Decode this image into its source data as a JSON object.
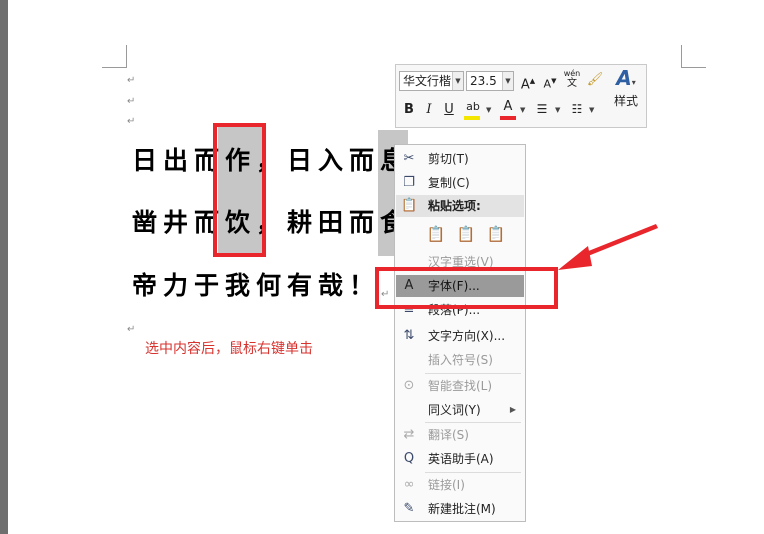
{
  "document": {
    "line1": "日出而作，日入而息",
    "line2": "凿井而饮，耕田而食",
    "line3": "帝力于我何有哉！",
    "paragraph_mark": "↵",
    "caption": "选中内容后，鼠标右键单击"
  },
  "mini_toolbar": {
    "font_name": "华文行楷",
    "font_size": "23.5",
    "grow_font": "A",
    "shrink_font": "A",
    "phonetic_top": "wén",
    "phonetic_bottom": "文",
    "bold": "B",
    "italic": "I",
    "underline": "U",
    "highlight": "ab",
    "font_color": "A",
    "styles_label": "样式"
  },
  "context_menu": {
    "items": [
      {
        "label": "剪切(T)",
        "icon": "scissors-icon"
      },
      {
        "label": "复制(C)",
        "icon": "copy-icon"
      },
      {
        "label": "粘贴选项:",
        "icon": "paste-icon"
      },
      {
        "label": "汉字重选(V)",
        "icon": ""
      },
      {
        "label": "字体(F)...",
        "icon": "font-icon"
      },
      {
        "label": "段落(P)...",
        "icon": "paragraph-icon"
      },
      {
        "label": "文字方向(X)...",
        "icon": "text-direction-icon"
      },
      {
        "label": "插入符号(S)",
        "icon": ""
      },
      {
        "label": "智能查找(L)",
        "icon": "smart-lookup-icon"
      },
      {
        "label": "同义词(Y)",
        "icon": ""
      },
      {
        "label": "翻译(S)",
        "icon": "translate-icon"
      },
      {
        "label": "英语助手(A)",
        "icon": "english-assistant-icon"
      },
      {
        "label": "链接(I)",
        "icon": "link-icon"
      },
      {
        "label": "新建批注(M)",
        "icon": "new-comment-icon"
      }
    ],
    "paste_options": [
      "keep-source-formatting-icon",
      "merge-formatting-icon",
      "keep-text-only-icon"
    ]
  },
  "colors": {
    "annotation_red": "#e8262b",
    "selection_gray": "#c6c6c6",
    "menu_highlight": "#9a9a9a"
  }
}
